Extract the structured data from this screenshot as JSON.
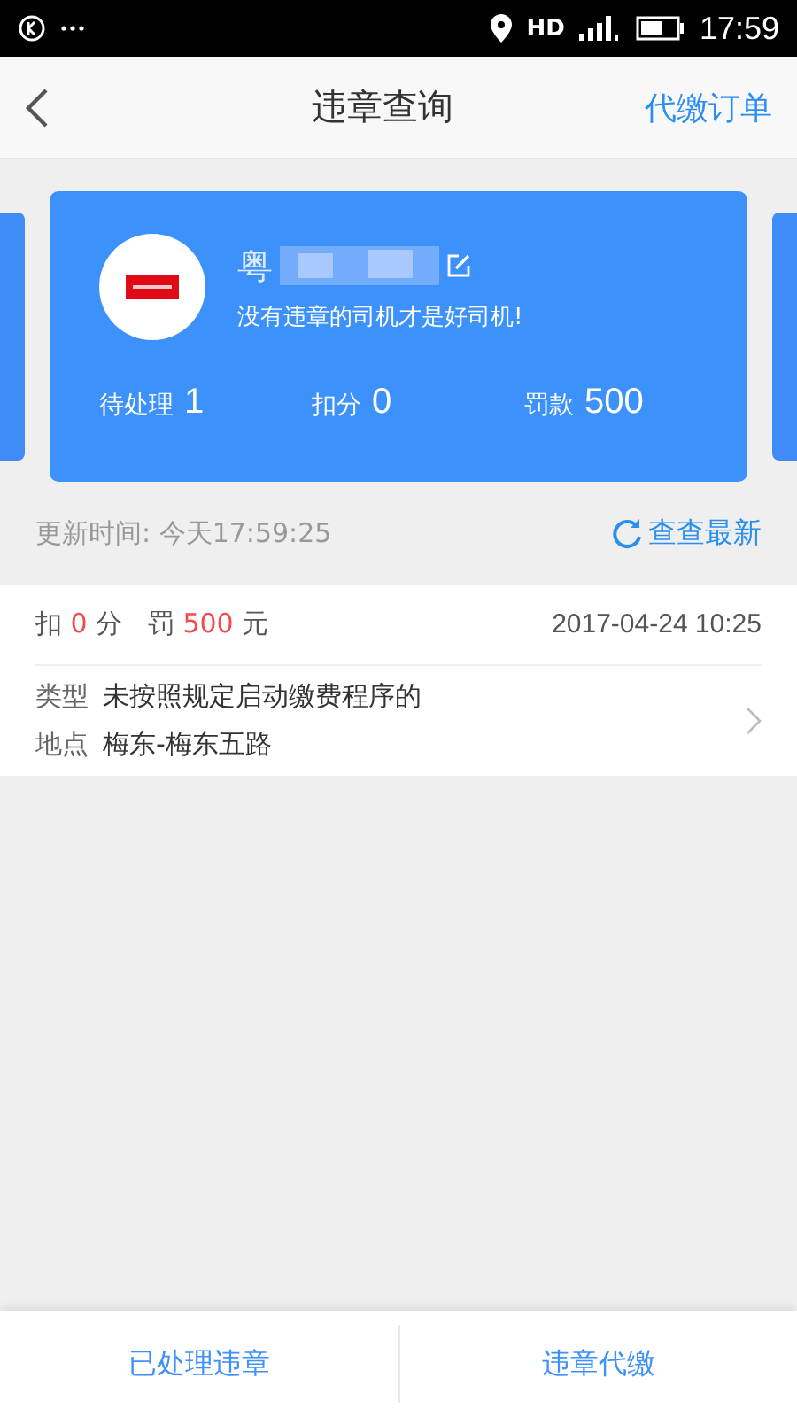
{
  "status_bar": {
    "network": "HD",
    "time": "17:59"
  },
  "header": {
    "title": "违章查询",
    "action": "代缴订单"
  },
  "car_card": {
    "plate": "粤",
    "slogan": "没有违章的司机才是好司机!",
    "stats": [
      {
        "label": "待处理",
        "value": "1"
      },
      {
        "label": "扣分",
        "value": "0"
      },
      {
        "label": "罚款",
        "value": "500"
      }
    ]
  },
  "update": {
    "time": "更新时间: 今天17:59:25",
    "refresh": "查查最新"
  },
  "violations": [
    {
      "deduct_label": "扣",
      "points": "0",
      "points_unit": "分",
      "fine_label": "罚",
      "fine": "500",
      "fine_unit": "元",
      "datetime": "2017-04-24 10:25",
      "type_label": "类型",
      "type": "未按照规定启动缴费程序的",
      "place_label": "地点",
      "place": "梅东-梅东五路"
    }
  ],
  "bottom_tabs": [
    "已处理违章",
    "违章代缴"
  ]
}
